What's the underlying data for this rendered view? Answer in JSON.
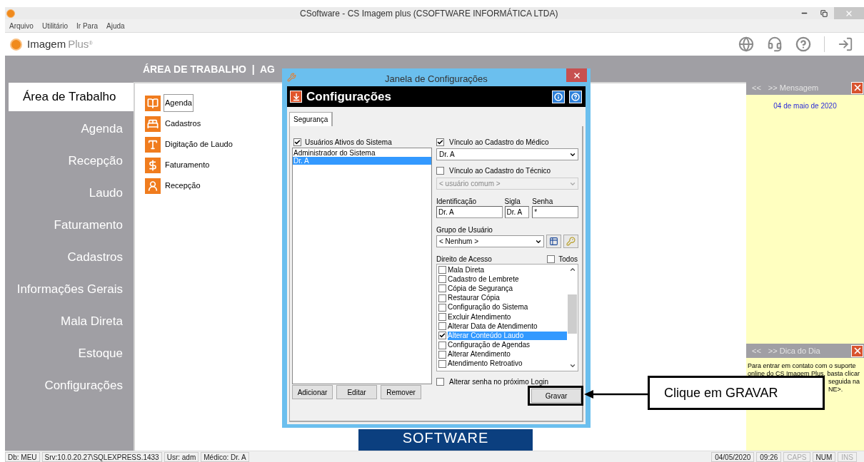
{
  "window": {
    "title": "CSoftware - CS Imagem plus (CSOFTWARE INFORMÁTICA LTDA)"
  },
  "menu": [
    "Arquivo",
    "Utilitário",
    "Ir Para",
    "Ajuda"
  ],
  "brand": {
    "name": "Imagem",
    "suffix": "Plus",
    "mark": "®"
  },
  "sidebar": {
    "items": [
      {
        "label": "Área de Trabalho",
        "selected": true
      },
      {
        "label": "Agenda",
        "selected": false
      },
      {
        "label": "Recepção",
        "selected": false
      },
      {
        "label": "Laudo",
        "selected": false
      },
      {
        "label": "Faturamento",
        "selected": false
      },
      {
        "label": "Cadastros",
        "selected": false
      },
      {
        "label": "Informações Gerais",
        "selected": false
      },
      {
        "label": "Mala Direta",
        "selected": false
      },
      {
        "label": "Estoque",
        "selected": false
      },
      {
        "label": "Configurações",
        "selected": false
      }
    ]
  },
  "breadcrumb": "ÁREA DE TRABALHO  |  AG",
  "shortcuts": [
    {
      "label": "Agenda",
      "kind": "agenda",
      "selected": true
    },
    {
      "label": "Cadastros",
      "kind": "cadastros",
      "selected": false
    },
    {
      "label": "Digitação de Laudo",
      "kind": "laudo",
      "selected": false
    },
    {
      "label": "Faturamento",
      "kind": "faturamento",
      "selected": false
    },
    {
      "label": "Recepção",
      "kind": "recepcao",
      "selected": false
    }
  ],
  "logo_text": "SOFTWARE",
  "message_panel": {
    "prev": "<<",
    "title": ">> Mensagem",
    "date": "04 de maio de 2020"
  },
  "tip_panel": {
    "prev": "<<",
    "title": ">> Dica do Dia",
    "lines": [
      "Para entrar em contato com o suporte",
      "online do CS Imagem Plus, basta clicar"
    ],
    "tail_lines": [
      "seguida na",
      "NE>."
    ]
  },
  "dialog": {
    "title": "Janela de Configurações",
    "heading": "Configurações",
    "tabs": [
      {
        "label": "Segurança",
        "selected": true
      }
    ],
    "users": {
      "label": "Usuários Ativos do Sistema",
      "checked": true,
      "items": [
        {
          "label": "Administrador do Sistema",
          "selected": false
        },
        {
          "label": "Dr. A",
          "selected": true
        }
      ]
    },
    "buttons": [
      "Adicionar",
      "Editar",
      "Remover"
    ],
    "doctor_link": {
      "label": "Vínculo ao Cadastro do Médico",
      "checked": true,
      "value": "Dr. A",
      "disabled": false
    },
    "tech_link": {
      "label": "Vínculo ao Cadastro do Técnico",
      "checked": false,
      "value": "< usuário comum >",
      "disabled": true
    },
    "fields": [
      {
        "label": "Identificação",
        "value": "Dr. A"
      },
      {
        "label": "Sigla",
        "value": "Dr. A"
      },
      {
        "label": "Senha",
        "value": "*"
      }
    ],
    "group": {
      "label": "Grupo de Usuário",
      "value": "< Nenhum >"
    },
    "access": {
      "label": "Direito de Acesso",
      "all": {
        "label": "Todos",
        "checked": false
      },
      "items": [
        {
          "label": "Mala Direta",
          "checked": false,
          "selected": false
        },
        {
          "label": "Cadastro de Lembrete",
          "checked": false,
          "selected": false
        },
        {
          "label": "Cópia de Segurança",
          "checked": false,
          "selected": false
        },
        {
          "label": "Restaurar Cópia",
          "checked": false,
          "selected": false
        },
        {
          "label": "Configuração do Sistema",
          "checked": false,
          "selected": false
        },
        {
          "label": "Excluir Atendimento",
          "checked": false,
          "selected": false
        },
        {
          "label": "Alterar Data de Atendimento",
          "checked": false,
          "selected": false
        },
        {
          "label": "Alterar Conteúdo Laudo",
          "checked": true,
          "selected": true
        },
        {
          "label": "Configuração de Agendas",
          "checked": false,
          "selected": false
        },
        {
          "label": "Alterar Atendimento",
          "checked": false,
          "selected": false
        },
        {
          "label": "Atendimento Retroativo",
          "checked": false,
          "selected": false
        }
      ]
    },
    "change_password": {
      "label": "Alterar senha no próximo Login",
      "checked": false
    },
    "save": "Gravar"
  },
  "callout": "Clique em GRAVAR",
  "status_bar": {
    "left": [
      "Db: MEU",
      "Srv:10.0.20.27\\SQLEXPRESS.1433",
      "Usr: adm",
      "Médico: Dr. A"
    ],
    "right": [
      {
        "label": "04/05/2020",
        "on": true
      },
      {
        "label": "09:26",
        "on": true
      },
      {
        "label": "CAPS",
        "on": false
      },
      {
        "label": "NUM",
        "on": true
      },
      {
        "label": "INS",
        "on": false
      }
    ]
  }
}
